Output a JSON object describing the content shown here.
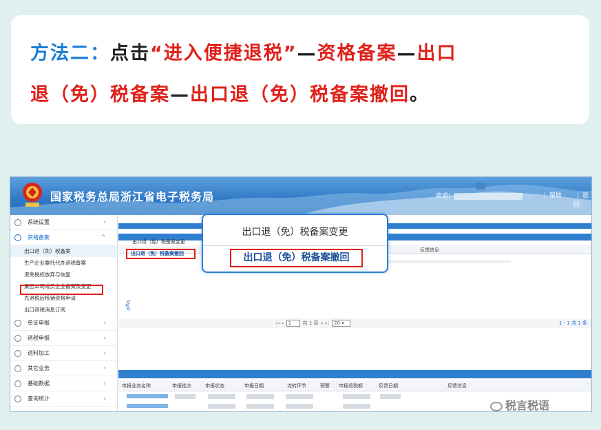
{
  "instruction": {
    "method": "方法二：",
    "click": "点击",
    "item1": "“进入便捷退税”",
    "dash1": "—",
    "item2": "资格备案",
    "dash2": "—",
    "item3_part1": "出口",
    "item3_part2": "退（免）税备案",
    "dash3": "—",
    "item4": "出口退（免）税备案撤回",
    "end": "。"
  },
  "app": {
    "title": "国家税务总局浙江省电子税务局",
    "welcome": "欢迎!",
    "help": "帮助",
    "back": "返回"
  },
  "sidebar": {
    "items": [
      {
        "label": "系统设置",
        "icon": "gear-icon"
      },
      {
        "label": "资格备案",
        "icon": "shield-icon"
      }
    ],
    "subitems": [
      "出口退（免）税备案",
      "生产企业委托代办退税备案",
      "退免税权放弃与恢复",
      "集团公司成员企业备案及变更",
      "先退税后核销资格申请",
      "出口退税消息订阅"
    ],
    "items2": [
      {
        "label": "单证申报",
        "icon": "document-icon"
      },
      {
        "label": "退税申报",
        "icon": "money-icon"
      },
      {
        "label": "进料加工",
        "icon": "box-icon"
      },
      {
        "label": "其它业务",
        "icon": "list-icon"
      },
      {
        "label": "基础数据",
        "icon": "database-icon"
      },
      {
        "label": "查询统计",
        "icon": "search-icon"
      }
    ]
  },
  "main": {
    "tab_change": "出口退（免）税备案变更",
    "tab_revoke": "出口退（免）税备案撤回",
    "feedback": "反馈信息",
    "collapse": "《",
    "pager": {
      "page": "1",
      "total_pages": "共 1 页",
      "page_size": "20",
      "summary": "1 - 1  共 1 条"
    },
    "columns": [
      "申报业务名称",
      "申报批次",
      "申报状态",
      "申报日期",
      "流转环节",
      "预警",
      "申报退税额",
      "反馈日期",
      "反馈信息"
    ]
  },
  "popup": {
    "option1": "出口退（免）税备案变更",
    "option2": "出口退（免）税备案撤回"
  },
  "watermark": "税言税语"
}
